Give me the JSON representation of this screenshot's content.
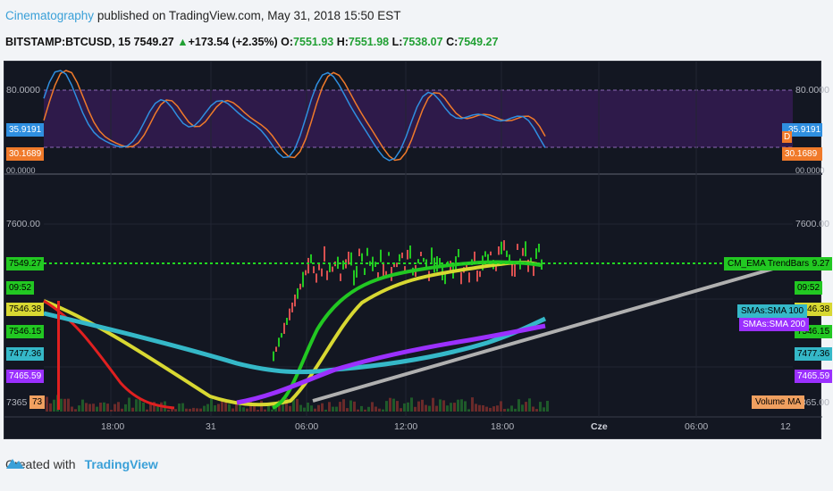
{
  "header": {
    "author": "Cinematography",
    "published": "published on TradingView.com, May 31, 2018 15:50 EST"
  },
  "symbol_bar": {
    "symbol": "BITSTAMP:BTCUSD, 15",
    "last": "7549.27",
    "change": "+173.54 (+2.35%)",
    "o_label": "O:",
    "o": "7551.93",
    "h_label": "H:",
    "h": "7551.98",
    "l_label": "L:",
    "l": "7538.07",
    "c_label": "C:",
    "c": "7549.27"
  },
  "stoch": {
    "levels": {
      "upper": "80.0000",
      "lower": "00.0000"
    },
    "k_value": "35.9191",
    "d_value": "30.1689",
    "d_letter": "D"
  },
  "price_axis": {
    "top": "7600.00",
    "bottom": "7365.00",
    "last_price": "7549.27",
    "countdown": "09:52",
    "sma_yellow": "7546.38",
    "ema_green": "7546.15",
    "sma100": "7477.36",
    "sma200": "7465.59",
    "volume_tag": "73"
  },
  "left_tags": {
    "last_price": "7549.27",
    "countdown": "09:52",
    "sma_yellow": "7546.38",
    "ema_green": "7546.15",
    "sma100": "7477.36",
    "sma200": "7465.59",
    "bottom": "7365",
    "volume": "73"
  },
  "labels": {
    "trendbars": "CM_EMA TrendBars",
    "sma100": "SMAs:SMA 100",
    "sma200": "SMAs:SMA 200",
    "volume_ma": "Volume MA"
  },
  "time_axis": [
    "18:00",
    "31",
    "06:00",
    "12:00",
    "18:00",
    "Cze",
    "06:00",
    "12"
  ],
  "footer": {
    "created_with": "Created with",
    "brand": "TradingView"
  },
  "colors": {
    "background": "#131722",
    "stoch_band": "#2e1a4a",
    "k_line": "#2f8fe0",
    "d_line": "#f07a2a",
    "ema_green": "#22c822",
    "sma_yellow": "#d8d832",
    "sma_cyan": "#35b8c8",
    "sma100": "#9b30ff",
    "sma_gray": "#b0b0b0",
    "trend_red": "#e02020"
  }
}
